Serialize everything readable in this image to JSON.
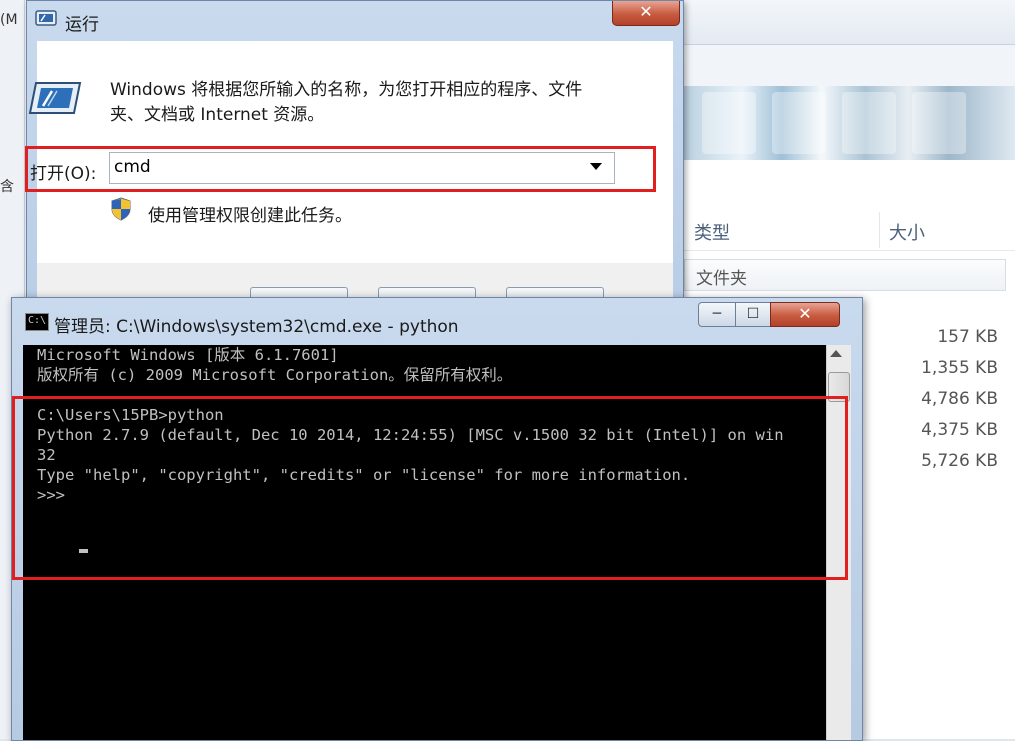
{
  "background_explorer": {
    "left_strip_texts": [
      "(M",
      "含"
    ],
    "columns": {
      "type": "类型",
      "size": "大小"
    },
    "folder_row_type": "文件夹",
    "sizes": [
      "157 KB",
      "1,355 KB",
      "4,786 KB",
      "4,375 KB",
      "5,726 KB"
    ]
  },
  "run_dialog": {
    "title": "运行",
    "close_glyph": "✕",
    "description_line1": "Windows 将根据您所输入的名称，为您打开相应的程序、文件",
    "description_line2": "夹、文档或 Internet 资源。",
    "open_label": "打开(O):",
    "open_value": "cmd",
    "admin_note": "使用管理权限创建此任务。",
    "highlight_color": "#e02020"
  },
  "cmd_window": {
    "title": "管理员: C:\\Windows\\system32\\cmd.exe - python",
    "icon_text": "C:\\",
    "buttons": {
      "minimize": "─",
      "maximize": "☐",
      "close": "✕"
    },
    "console_lines": [
      "Microsoft Windows [版本 6.1.7601]",
      "版权所有 (c) 2009 Microsoft Corporation。保留所有权利。",
      "",
      "C:\\Users\\15PB>python",
      "Python 2.7.9 (default, Dec 10 2014, 12:24:55) [MSC v.1500 32 bit (Intel)] on win",
      "32",
      "Type \"help\", \"copyright\", \"credits\" or \"license\" for more information.",
      ">>> "
    ],
    "console_bg": "#000000",
    "console_fg": "#c0c0c0"
  }
}
